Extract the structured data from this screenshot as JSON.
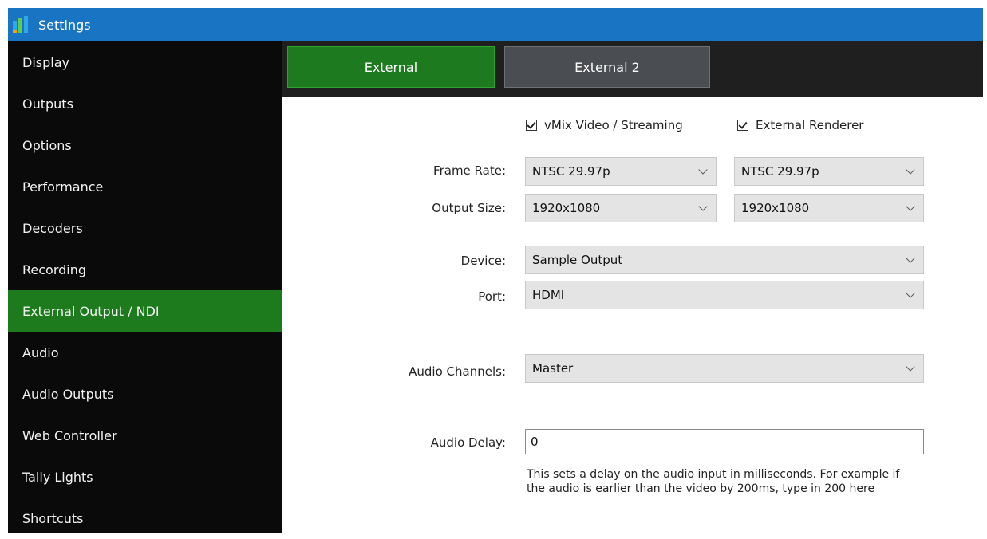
{
  "window": {
    "title": "Settings"
  },
  "sidebar": {
    "items": [
      {
        "label": "Display"
      },
      {
        "label": "Outputs"
      },
      {
        "label": "Options"
      },
      {
        "label": "Performance"
      },
      {
        "label": "Decoders"
      },
      {
        "label": "Recording"
      },
      {
        "label": "External Output / NDI",
        "active": true
      },
      {
        "label": "Audio"
      },
      {
        "label": "Audio Outputs"
      },
      {
        "label": "Web Controller"
      },
      {
        "label": "Tally Lights"
      },
      {
        "label": "Shortcuts"
      }
    ]
  },
  "tabs": [
    {
      "label": "External",
      "active": true
    },
    {
      "label": "External 2"
    }
  ],
  "checks": {
    "vmix": {
      "label": "vMix Video / Streaming",
      "checked": true
    },
    "renderer": {
      "label": "External Renderer",
      "checked": true
    }
  },
  "form": {
    "frame_rate": {
      "label": "Frame Rate:",
      "value1": "NTSC 29.97p",
      "value2": "NTSC 29.97p"
    },
    "output_size": {
      "label": "Output Size:",
      "value1": "1920x1080",
      "value2": "1920x1080"
    },
    "device": {
      "label": "Device:",
      "value": "Sample Output"
    },
    "port": {
      "label": "Port:",
      "value": "HDMI"
    },
    "audio_channels": {
      "label": "Audio Channels:",
      "value": "Master"
    },
    "audio_delay": {
      "label": "Audio Delay:",
      "value": "0",
      "help1": "This sets a delay on the audio input in milliseconds. For example if",
      "help2": "the audio is earlier than the video by 200ms, type in 200 here"
    }
  },
  "colors": {
    "titlebar": "#1a74c4",
    "active_green": "#1d7a1d",
    "sidebar_bg": "#0a0a0a",
    "tab_inactive": "#4a4d52"
  }
}
